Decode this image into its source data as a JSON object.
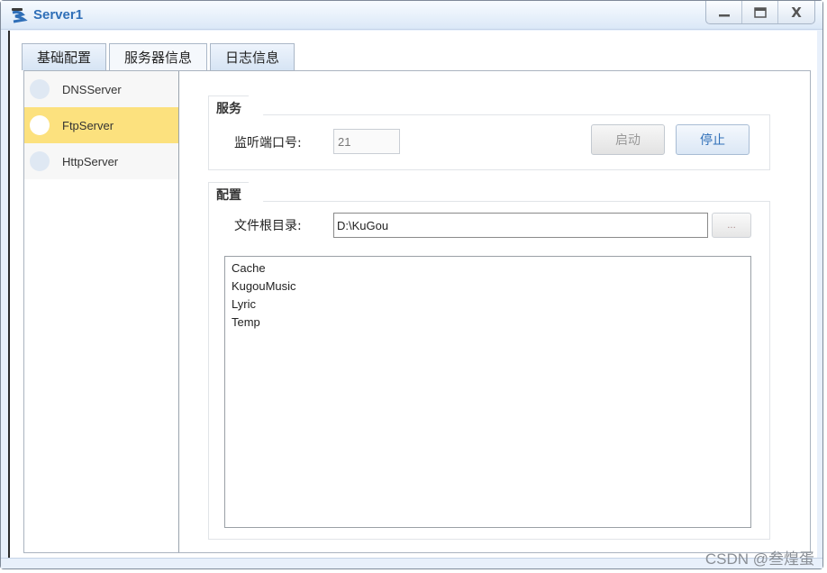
{
  "window": {
    "title": "Server1",
    "controls": {
      "minimize": "_",
      "maximize": "□",
      "close": "X"
    }
  },
  "tabs": [
    {
      "label": "基础配置",
      "active": false
    },
    {
      "label": "服务器信息",
      "active": true
    },
    {
      "label": "日志信息",
      "active": false
    }
  ],
  "servers": [
    {
      "label": "DNSServer",
      "selected": false
    },
    {
      "label": "FtpServer",
      "selected": true
    },
    {
      "label": "HttpServer",
      "selected": false
    }
  ],
  "service": {
    "group_title": "服务",
    "port_label": "监听端口号:",
    "port_value": "21",
    "start_label": "启动",
    "stop_label": "停止"
  },
  "config": {
    "group_title": "配置",
    "root_label": "文件根目录:",
    "root_value": "D:\\KuGou",
    "browse_label": "...",
    "files": [
      "Cache",
      "KugouMusic",
      "Lyric",
      "Temp"
    ]
  },
  "watermark": "CSDN @叁煌蛋",
  "colors": {
    "selected": "#fce17e",
    "accent": "#2f6fb8"
  }
}
